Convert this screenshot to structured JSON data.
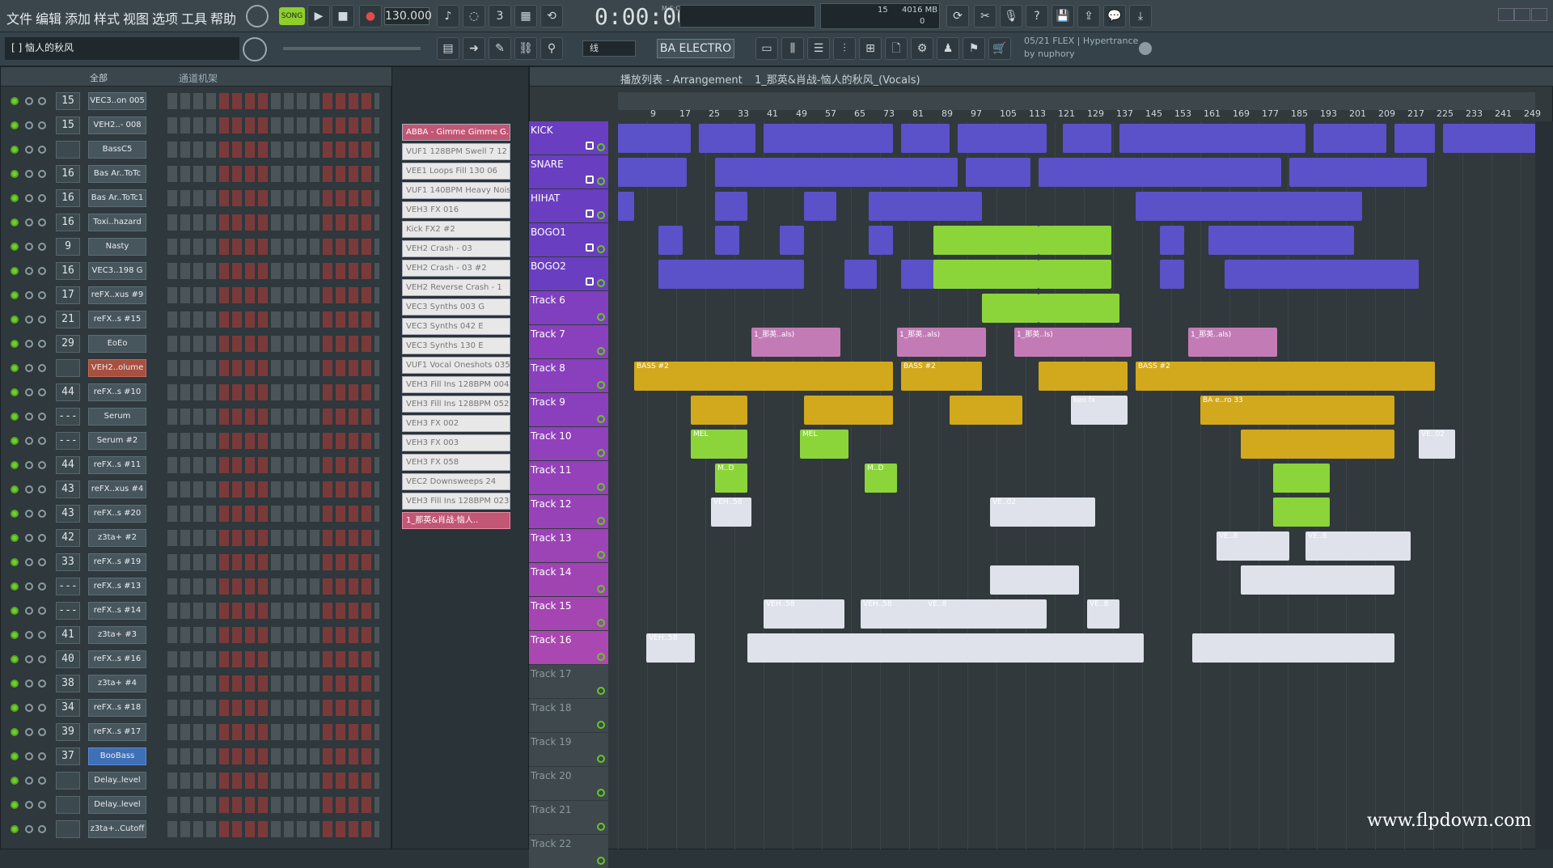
{
  "menu": [
    "文件",
    "编辑",
    "添加",
    "样式",
    "视图",
    "选项",
    "工具",
    "帮助"
  ],
  "toolbar": {
    "tempo": "130.000",
    "time": "0:00:00",
    "time_unit": "M:S:CS",
    "pattern_num": "15",
    "memory": "4016 MB",
    "mem_sub": "0",
    "song_label": "SONG",
    "pattern_name": "BA ELECTRO",
    "snap": "线",
    "hint_line1": "05/21  FLEX | Hypertrance",
    "hint_line2": "by nuphory",
    "song_title": "[ ] 恼人的秋风"
  },
  "left": {
    "filter": "全部",
    "rack_title": "通道机架",
    "channels": [
      {
        "num": "15",
        "name": "VEC3..on 005"
      },
      {
        "num": "15",
        "name": "VEH2..- 008"
      },
      {
        "num": "",
        "name": "BassC5"
      },
      {
        "num": "16",
        "name": "Bas Ar..ToTc"
      },
      {
        "num": "16",
        "name": "Bas Ar..ToTc1"
      },
      {
        "num": "16",
        "name": "Toxi..hazard"
      },
      {
        "num": "9",
        "name": "Nasty"
      },
      {
        "num": "16",
        "name": "VEC3..198 G"
      },
      {
        "num": "17",
        "name": "reFX..xus #9"
      },
      {
        "num": "21",
        "name": "reFX..s #15"
      },
      {
        "num": "29",
        "name": "EoEo"
      },
      {
        "num": "",
        "name": "VEH2..olume"
      },
      {
        "num": "44",
        "name": "reFX..s #10"
      },
      {
        "num": "---",
        "name": "Serum"
      },
      {
        "num": "---",
        "name": "Serum #2"
      },
      {
        "num": "44",
        "name": "reFX..s #11"
      },
      {
        "num": "43",
        "name": "reFX..xus #4"
      },
      {
        "num": "43",
        "name": "reFX..s #20"
      },
      {
        "num": "42",
        "name": "z3ta+ #2"
      },
      {
        "num": "33",
        "name": "reFX..s #19"
      },
      {
        "num": "---",
        "name": "reFX..s #13"
      },
      {
        "num": "---",
        "name": "reFX..s #14"
      },
      {
        "num": "41",
        "name": "z3ta+ #3"
      },
      {
        "num": "40",
        "name": "reFX..s #16"
      },
      {
        "num": "38",
        "name": "z3ta+ #4"
      },
      {
        "num": "34",
        "name": "reFX..s #18"
      },
      {
        "num": "39",
        "name": "reFX..s #17"
      },
      {
        "num": "37",
        "name": "BooBass"
      },
      {
        "num": "",
        "name": "Delay..level"
      },
      {
        "num": "",
        "name": "Delay..level"
      },
      {
        "num": "",
        "name": "z3ta+..Cutoff"
      }
    ]
  },
  "browser": [
    "ABBA - Gimme Gimme G..",
    "VUF1 128BPM Swell 7 12",
    "VEE1 Loops Fill 130 06",
    "VUF1 140BPM Heavy Nois",
    "VEH3 FX 016",
    "Kick FX2 #2",
    "VEH2 Crash - 03",
    "VEH2 Crash - 03 #2",
    "VEH2 Reverse Crash - 1",
    "VEC3 Synths 003 G",
    "VEC3 Synths 042 E",
    "VEC3 Synths 130 E",
    "VUF1 Vocal Oneshots 035",
    "VEH3 Fill Ins 128BPM 004",
    "VEH3 Fill Ins 128BPM 052",
    "VEH3 FX 002",
    "VEH3 FX 003",
    "VEH3 FX 058",
    "VEC2 Downsweeps 24",
    "VEH3 Fill Ins 128BPM 023",
    "1_那英&肖战-恼人.."
  ],
  "arrangement": {
    "title": "播放列表 - Arrangement",
    "path": "1_那英&肖战-恼人的秋风_(Vocals)",
    "ruler": [
      "9",
      "17",
      "25",
      "33",
      "41",
      "49",
      "57",
      "65",
      "73",
      "81",
      "89",
      "97",
      "105",
      "113",
      "121",
      "129",
      "137",
      "145",
      "153",
      "161",
      "169",
      "177",
      "185",
      "193",
      "201",
      "209",
      "217",
      "225",
      "233",
      "241",
      "249"
    ],
    "tracks": [
      "KICK",
      "SNARE",
      "HIHAT",
      "BOGO1",
      "BOGO2",
      "Track 6",
      "Track 7",
      "Track 8",
      "Track 9",
      "Track 10",
      "Track 11",
      "Track 12",
      "Track 13",
      "Track 14",
      "Track 15",
      "Track 16",
      "Track 17",
      "Track 18",
      "Track 19",
      "Track 20",
      "Track 21",
      "Track 22"
    ],
    "clip_labels": {
      "vocal": "1_那英..als)",
      "vocal2": "1_那英..ls)",
      "bass": "BASS #2",
      "bass2": "BA e..ro 33",
      "mel": "MEL",
      "md": "M..D",
      "veh58": "VEH..58",
      "veh02": "VE..02",
      "ve8": "VE..8",
      "keofx": "keo fx"
    }
  },
  "watermark": "www.flpdown.com"
}
